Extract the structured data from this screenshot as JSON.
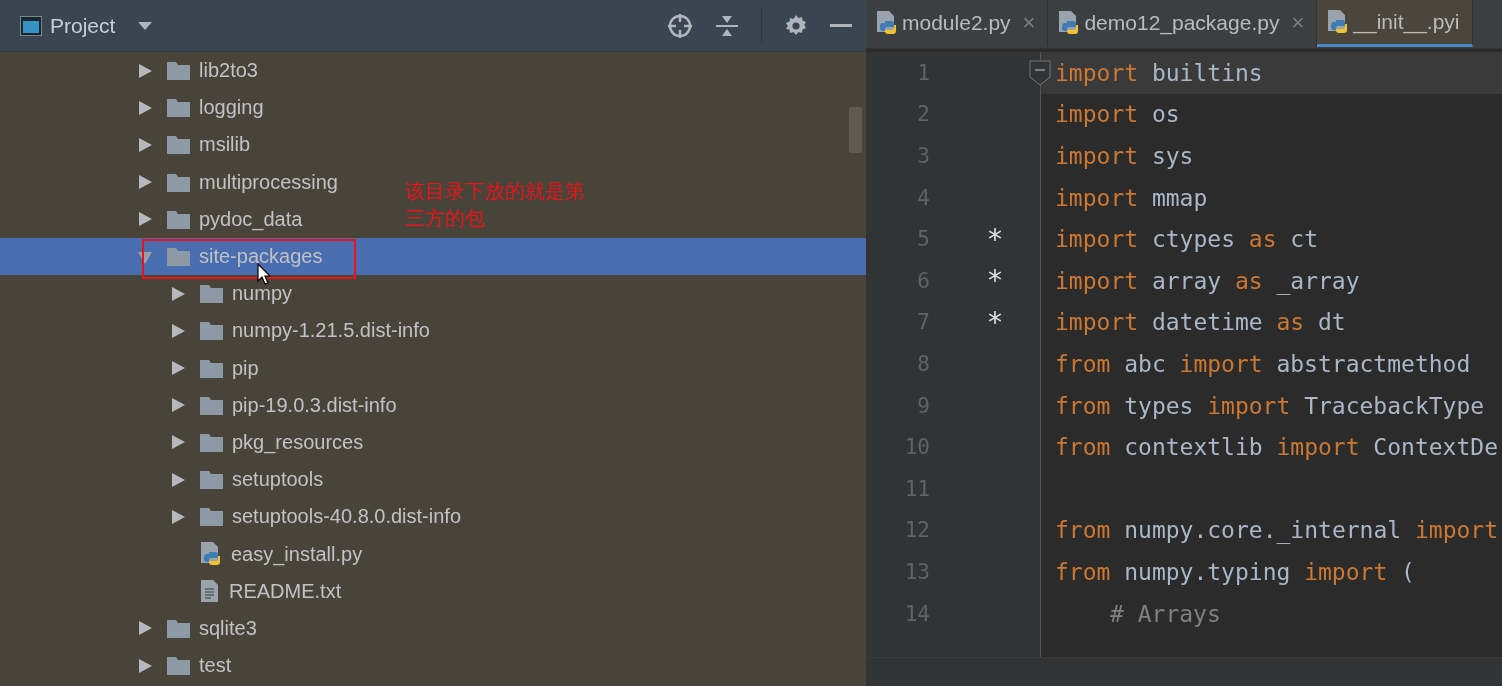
{
  "project_panel": {
    "title": "Project",
    "tree": [
      {
        "label": "lib2to3",
        "kind": "folder",
        "expanded": false,
        "selected": false
      },
      {
        "label": "logging",
        "kind": "folder",
        "expanded": false,
        "selected": false
      },
      {
        "label": "msilib",
        "kind": "folder",
        "expanded": false,
        "selected": false
      },
      {
        "label": "multiprocessing",
        "kind": "folder",
        "expanded": false,
        "selected": false
      },
      {
        "label": "pydoc_data",
        "kind": "folder",
        "expanded": false,
        "selected": false
      },
      {
        "label": "site-packages",
        "kind": "folder",
        "expanded": true,
        "selected": true,
        "children": [
          {
            "label": "numpy",
            "kind": "folder",
            "expanded": false,
            "selected": false
          },
          {
            "label": "numpy-1.21.5.dist-info",
            "kind": "folder",
            "expanded": false,
            "selected": false
          },
          {
            "label": "pip",
            "kind": "folder",
            "expanded": false,
            "selected": false
          },
          {
            "label": "pip-19.0.3.dist-info",
            "kind": "folder",
            "expanded": false,
            "selected": false
          },
          {
            "label": "pkg_resources",
            "kind": "folder",
            "expanded": false,
            "selected": false
          },
          {
            "label": "setuptools",
            "kind": "folder",
            "expanded": false,
            "selected": false
          },
          {
            "label": "setuptools-40.8.0.dist-info",
            "kind": "folder",
            "expanded": false,
            "selected": false
          },
          {
            "label": "easy_install.py",
            "kind": "python-file",
            "selected": false
          },
          {
            "label": "README.txt",
            "kind": "text-file",
            "selected": false
          }
        ]
      },
      {
        "label": "sqlite3",
        "kind": "folder",
        "expanded": false,
        "selected": false
      },
      {
        "label": "test",
        "kind": "folder",
        "expanded": false,
        "selected": false
      }
    ],
    "annotation": "该目录下放的就是第三方的包"
  },
  "editor": {
    "tabs": [
      {
        "label": "module2.py",
        "selected": false,
        "close": "×"
      },
      {
        "label": "demo12_package.py",
        "selected": false,
        "close": "×"
      },
      {
        "label": "__init__.pyi",
        "selected": true
      }
    ],
    "lines": [
      {
        "number": "1",
        "current": true,
        "tokens": [
          {
            "text": "import",
            "kind": "keyword"
          },
          {
            "text": "builtins",
            "kind": "name"
          }
        ]
      },
      {
        "number": "2",
        "current": false,
        "tokens": [
          {
            "text": "import",
            "kind": "keyword"
          },
          {
            "text": "os",
            "kind": "name"
          }
        ]
      },
      {
        "number": "3",
        "current": false,
        "tokens": [
          {
            "text": "import",
            "kind": "keyword"
          },
          {
            "text": "sys",
            "kind": "name"
          }
        ]
      },
      {
        "number": "4",
        "current": false,
        "tokens": [
          {
            "text": "import",
            "kind": "keyword"
          },
          {
            "text": "mmap",
            "kind": "name"
          }
        ]
      },
      {
        "number": "5",
        "current": false,
        "marker": "*",
        "tokens": [
          {
            "text": "import",
            "kind": "keyword"
          },
          {
            "text": "ctypes",
            "kind": "name"
          },
          {
            "text": "as",
            "kind": "keyword"
          },
          {
            "text": "ct",
            "kind": "name"
          }
        ]
      },
      {
        "number": "6",
        "current": false,
        "marker": "*",
        "tokens": [
          {
            "text": "import",
            "kind": "keyword"
          },
          {
            "text": "array",
            "kind": "name"
          },
          {
            "text": "as",
            "kind": "keyword"
          },
          {
            "text": "_array",
            "kind": "name"
          }
        ]
      },
      {
        "number": "7",
        "current": false,
        "marker": "*",
        "tokens": [
          {
            "text": "import",
            "kind": "keyword"
          },
          {
            "text": "datetime",
            "kind": "name"
          },
          {
            "text": "as",
            "kind": "keyword"
          },
          {
            "text": "dt",
            "kind": "name"
          }
        ]
      },
      {
        "number": "8",
        "current": false,
        "tokens": [
          {
            "text": "from",
            "kind": "keyword"
          },
          {
            "text": "abc",
            "kind": "name"
          },
          {
            "text": "import",
            "kind": "keyword"
          },
          {
            "text": "abstractmethod",
            "kind": "name"
          }
        ]
      },
      {
        "number": "9",
        "current": false,
        "tokens": [
          {
            "text": "from",
            "kind": "keyword"
          },
          {
            "text": "types",
            "kind": "name"
          },
          {
            "text": "import",
            "kind": "keyword"
          },
          {
            "text": "TracebackType",
            "kind": "name"
          }
        ]
      },
      {
        "number": "10",
        "current": false,
        "tokens": [
          {
            "text": "from",
            "kind": "keyword"
          },
          {
            "text": "contextlib",
            "kind": "name"
          },
          {
            "text": "import",
            "kind": "keyword"
          },
          {
            "text": "ContextDe",
            "kind": "name"
          }
        ]
      },
      {
        "number": "11",
        "current": false
      },
      {
        "number": "12",
        "current": false,
        "tokens": [
          {
            "text": "from",
            "kind": "keyword"
          },
          {
            "text": "numpy.core._internal",
            "kind": "name"
          },
          {
            "text": "import",
            "kind": "keyword"
          }
        ]
      },
      {
        "number": "13",
        "current": false,
        "tokens": [
          {
            "text": "from",
            "kind": "keyword"
          },
          {
            "text": "numpy.typing",
            "kind": "name"
          },
          {
            "text": "import",
            "kind": "keyword"
          },
          {
            "text": "(",
            "kind": "name"
          }
        ]
      },
      {
        "number": "14",
        "current": false,
        "indented": true,
        "tokens": [
          {
            "text": "# Arrays",
            "kind": "comment"
          }
        ]
      }
    ]
  }
}
